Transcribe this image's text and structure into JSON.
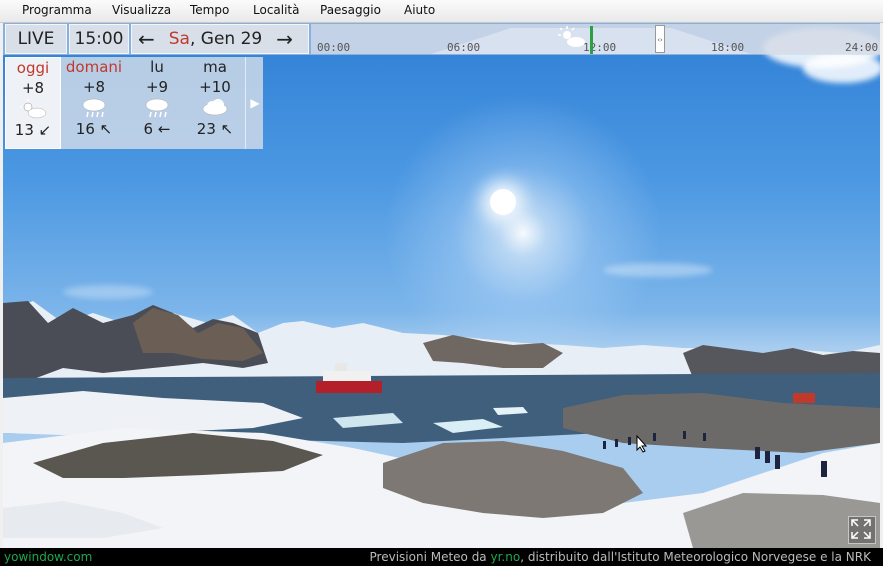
{
  "menu": {
    "items": [
      "Programma",
      "Visualizza",
      "Tempo",
      "Località",
      "Paesaggio",
      "Aiuto"
    ]
  },
  "toolbar": {
    "live_label": "LIVE",
    "time": "15:00",
    "prev_arrow": "←",
    "next_arrow": "→",
    "date_day": "Sa",
    "date_rest": ", Gen 29"
  },
  "timeline": {
    "labels": [
      "00:00",
      "06:00",
      "12:00",
      "18:00",
      "24:00"
    ],
    "current_marker_color": "#2ea043"
  },
  "forecast": {
    "days": [
      {
        "name": "oggi",
        "temp": "+8",
        "icon": "sun-cloud-icon",
        "wind": "13 ↙",
        "highlight": true
      },
      {
        "name": "domani",
        "temp": "+8",
        "icon": "rain-cloud-icon",
        "wind": "16 ↖",
        "highlight": true
      },
      {
        "name": "lu",
        "temp": "+9",
        "icon": "rain-cloud-icon",
        "wind": "6 ←",
        "highlight": false
      },
      {
        "name": "ma",
        "temp": "+10",
        "icon": "cloud-icon",
        "wind": "23 ↖",
        "highlight": false
      }
    ],
    "more_arrow": "▶"
  },
  "status": {
    "left": "yowindow.com",
    "right_prefix": "Previsioni Meteo da",
    "right_link": "yr.no",
    "right_suffix": ", distribuito dall'Istituto Meteorologico Norvegese e la NRK"
  },
  "colors": {
    "accent_red": "#c0392b",
    "status_green": "#1fa84a"
  }
}
